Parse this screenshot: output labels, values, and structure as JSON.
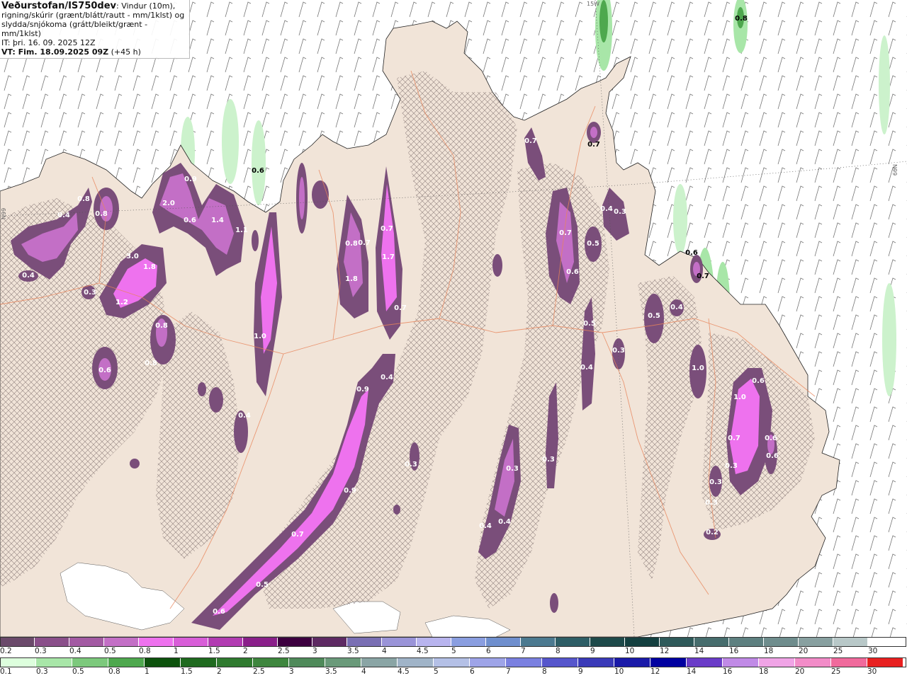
{
  "header": {
    "title": "Veðurstofan/IS750dev",
    "line1_rest": ": Vindur (10m),",
    "line2": "rigning/skúrir (grænt/blátt/rautt - mm/1klst) og",
    "line3": "slydda/snjókoma (grátt/bleikt/grænt - mm/1klst)",
    "it_line": "IT: þri. 16. 09. 2025 12Z",
    "vt_label": "VT: Fim. 18.09.2025 09Z",
    "vt_offset": " (+45 h)"
  },
  "grid_labels": {
    "top_lon": "15W",
    "left_lat": "N99",
    "right_lat": "N99"
  },
  "colorbar_snow": {
    "labels": [
      "0.2",
      "0.3",
      "0.4",
      "0.5",
      "0.8",
      "1",
      "1.5",
      "2",
      "2.5",
      "3",
      "3.5",
      "4",
      "4.5",
      "5",
      "6",
      "7",
      "8",
      "9",
      "10",
      "12",
      "14",
      "16",
      "18",
      "20",
      "25",
      "30"
    ],
    "colors": [
      "#6b4a6b",
      "#8a4f8a",
      "#a35aa3",
      "#c36fc6",
      "#ee72ee",
      "#d85ed8",
      "#b23cb2",
      "#8a1f8a",
      "#3d0040",
      "#5e2a63",
      "#7a6fb4",
      "#9a94d8",
      "#b8b4ee",
      "#8a9ee0",
      "#6f8fce",
      "#4c7a90",
      "#2e5e66",
      "#1e4a4a",
      "#144040",
      "#2f5a5a",
      "#476d6d",
      "#5e8080",
      "#6f8d8d",
      "#88a0a0",
      "#b8c8c8",
      "#ffffff"
    ]
  },
  "colorbar_rain": {
    "labels": [
      "0.1",
      "0.3",
      "0.5",
      "0.8",
      "1",
      "1.5",
      "2",
      "2.5",
      "3",
      "3.5",
      "4",
      "4.5",
      "5",
      "6",
      "7",
      "8",
      "9",
      "10",
      "12",
      "14",
      "16",
      "18",
      "20",
      "25",
      "30"
    ],
    "colors": [
      "#ddffdd",
      "#a8e6a8",
      "#7cc97c",
      "#4ea84e",
      "#0d520d",
      "#1f6a1f",
      "#2f7a2f",
      "#3e863e",
      "#4f8a5a",
      "#6a9a7a",
      "#8aa5a5",
      "#a0b4c8",
      "#b4c0e6",
      "#9ea4e8",
      "#7a80e0",
      "#5656cc",
      "#3a3ab8",
      "#1a1aa8",
      "#0000a0",
      "#6a3cc8",
      "#c08ae6",
      "#f0a4e6",
      "#f28cc8",
      "#f06a9c",
      "#e82020"
    ]
  },
  "snow_labels": [
    "0.8",
    "0.4",
    "0.8",
    "2.0",
    "0.9",
    "0.6",
    "1.4",
    "1.1",
    "3.0",
    "1.8",
    "1.2",
    "0.3",
    "0.8",
    "0.6",
    "0.8",
    "1.2",
    "0.4",
    "1.0",
    "0.4",
    "0.8",
    "0.7",
    "0.7",
    "1.7",
    "1.8",
    "0.7",
    "0.5",
    "0.9",
    "0.4",
    "0.9",
    "0.7",
    "0.5",
    "0.6",
    "0.4",
    "0.4",
    "0.3",
    "0.7",
    "0.7",
    "0.6",
    "0.5",
    "0.4",
    "0.3",
    "0.5",
    "0.4",
    "0.3",
    "0.4",
    "1.0",
    "0.6",
    "1.0",
    "0.7",
    "0.3",
    "0.6",
    "0.6",
    "0.3",
    "0.3",
    "0.2",
    "0.3",
    "0.3"
  ],
  "rain_labels": [
    "0.6",
    "0.7",
    "0.8",
    "0.6",
    "0.7"
  ]
}
